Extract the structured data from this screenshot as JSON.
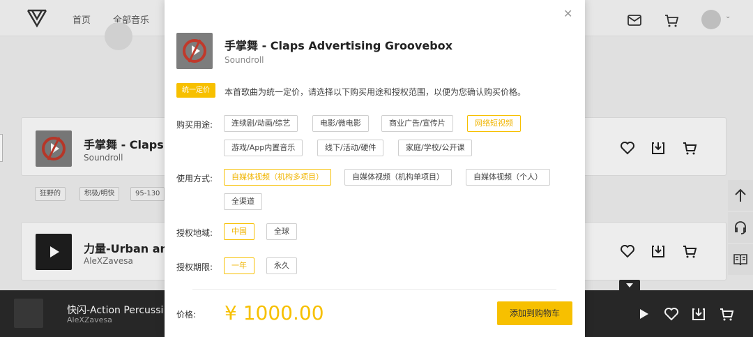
{
  "nav": {
    "home": "首页",
    "all_music": "全部音乐"
  },
  "tracks": [
    {
      "title": "手掌舞 - Claps A",
      "artist": "Soundroll"
    },
    {
      "title": "力量-Urban and",
      "artist": "AleXZavesa"
    }
  ],
  "tags": [
    "狂野的",
    "积极/明快",
    "95-130"
  ],
  "player": {
    "title": "快闪-Action Percussi",
    "artist": "AleXZavesa"
  },
  "modal": {
    "title": "手掌舞 - Claps Advertising Groovebox",
    "artist": "Soundroll",
    "badge": "统一定价",
    "notice": "本首歌曲为统一定价，请选择以下购买用途和授权范围，以便为您确认购买价格。",
    "usage": {
      "label": "购买用途:",
      "options": [
        "连续剧/动画/综艺",
        "电影/微电影",
        "商业广告/宣传片",
        "网络短视频",
        "游戏/App内置音乐",
        "线下/活动/硬件",
        "家庭/学校/公开课"
      ],
      "selected": "网络短视频"
    },
    "method": {
      "label": "使用方式:",
      "options": [
        "自媒体视频（机构多项目）",
        "自媒体视频（机构单项目）",
        "自媒体视频（个人）",
        "全渠道"
      ],
      "selected": "自媒体视频（机构多项目）"
    },
    "region": {
      "label": "授权地域:",
      "options": [
        "中国",
        "全球"
      ],
      "selected": "中国"
    },
    "period": {
      "label": "授权期限:",
      "options": [
        "一年",
        "永久"
      ],
      "selected": "一年"
    },
    "price_label": "价格:",
    "price": "¥ 1000.00",
    "add_to_cart": "添加到购物车"
  },
  "colors": {
    "accent": "#f7c000",
    "player_bg": "#2a2a2a"
  }
}
